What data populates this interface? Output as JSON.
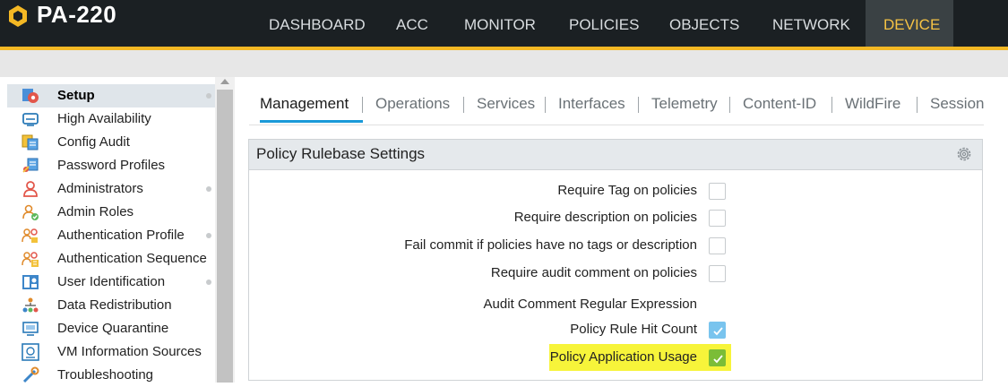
{
  "app": {
    "title": "PA-220"
  },
  "nav": {
    "items": [
      {
        "label": "DASHBOARD"
      },
      {
        "label": "ACC"
      },
      {
        "label": "MONITOR"
      },
      {
        "label": "POLICIES"
      },
      {
        "label": "OBJECTS"
      },
      {
        "label": "NETWORK"
      },
      {
        "label": "DEVICE",
        "active": true
      }
    ]
  },
  "sidebar": {
    "items": [
      {
        "label": "Setup",
        "icon": "setup-icon",
        "selected": true,
        "has_dot": true
      },
      {
        "label": "High Availability",
        "icon": "high-availability-icon"
      },
      {
        "label": "Config Audit",
        "icon": "config-audit-icon"
      },
      {
        "label": "Password Profiles",
        "icon": "password-profiles-icon"
      },
      {
        "label": "Administrators",
        "icon": "administrators-icon",
        "has_dot": true
      },
      {
        "label": "Admin Roles",
        "icon": "admin-roles-icon"
      },
      {
        "label": "Authentication Profile",
        "icon": "authentication-profile-icon",
        "has_dot": true
      },
      {
        "label": "Authentication Sequence",
        "icon": "authentication-sequence-icon"
      },
      {
        "label": "User Identification",
        "icon": "user-identification-icon",
        "has_dot": true
      },
      {
        "label": "Data Redistribution",
        "icon": "data-redistribution-icon"
      },
      {
        "label": "Device Quarantine",
        "icon": "device-quarantine-icon"
      },
      {
        "label": "VM Information Sources",
        "icon": "vm-information-sources-icon"
      },
      {
        "label": "Troubleshooting",
        "icon": "troubleshooting-icon"
      }
    ]
  },
  "tabs": [
    {
      "label": "Management",
      "active": true
    },
    {
      "label": "Operations"
    },
    {
      "label": "Services"
    },
    {
      "label": "Interfaces"
    },
    {
      "label": "Telemetry"
    },
    {
      "label": "Content-ID"
    },
    {
      "label": "WildFire"
    },
    {
      "label": "Session"
    }
  ],
  "panel": {
    "title": "Policy Rulebase Settings",
    "gear_icon": "gear-icon",
    "rows": [
      {
        "label": "Require Tag on policies",
        "checked": false
      },
      {
        "label": "Require description on policies",
        "checked": false
      },
      {
        "label": "Fail commit if policies have no tags or description",
        "checked": false
      },
      {
        "label": "Require audit comment on policies",
        "checked": false
      },
      {
        "label": "Audit Comment Regular Expression"
      },
      {
        "label": "Policy Rule Hit Count",
        "checked": true
      },
      {
        "label": "Policy Application Usage",
        "checked": true,
        "highlighted": true
      }
    ]
  },
  "colors": {
    "accent": "#f4b824",
    "active_nav_text": "#f6c344",
    "tab_underline": "#1a9ad8",
    "checkbox_checked": "#79c4ee",
    "checkbox_highlighted": "#7bbd37",
    "highlight": "#f7f43a"
  }
}
